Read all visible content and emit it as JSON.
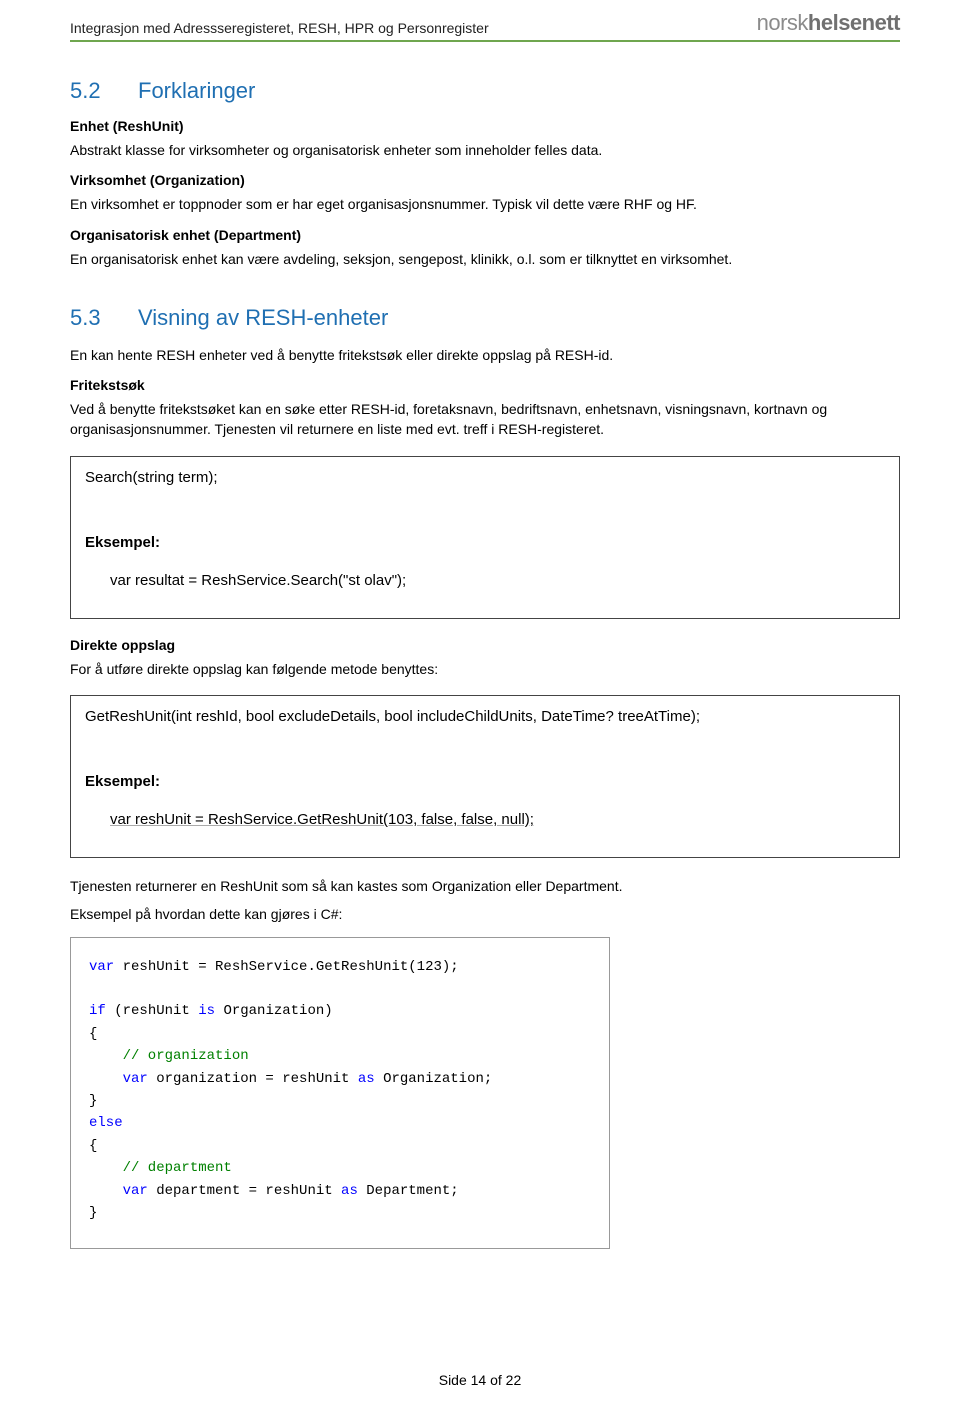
{
  "header": {
    "title": "Integrasjon med Adressseregisteret, RESH, HPR og Personregister",
    "logo_light": "norsk",
    "logo_bold": "helsenett"
  },
  "section_5_2": {
    "num": "5.2",
    "title": "Forklaringer",
    "terms": [
      {
        "name": "Enhet (ReshUnit)",
        "desc": "Abstrakt klasse for virksomheter og organisatorisk enheter som inneholder felles data."
      },
      {
        "name": "Virksomhet (Organization)",
        "desc": "En virksomhet er toppnoder som er har eget organisasjonsnummer. Typisk vil dette være RHF og HF."
      },
      {
        "name": "Organisatorisk enhet (Department)",
        "desc": "En organisatorisk enhet kan være avdeling, seksjon, sengepost, klinikk, o.l. som er tilknyttet en virksomhet."
      }
    ]
  },
  "section_5_3": {
    "num": "5.3",
    "title": "Visning av RESH-enheter",
    "intro": "En kan hente RESH enheter ved å benytte fritekstsøk eller direkte oppslag på RESH-id.",
    "fritekst_title": "Fritekstsøk",
    "fritekst_desc": "Ved å benytte fritekstsøket kan en søke etter RESH-id, foretaksnavn, bedriftsnavn, enhetsnavn, visningsnavn, kortnavn og organisasjonsnummer. Tjenesten vil returnere en liste med evt. treff i RESH-registeret.",
    "codebox1": {
      "signature": "Search(string term);",
      "example_label": "Eksempel:",
      "example_code": "var resultat = ReshService.Search(\"st olav\");"
    },
    "direkte_title": "Direkte oppslag",
    "direkte_desc": "For å utføre direkte oppslag kan følgende metode benyttes:",
    "codebox2": {
      "signature": "GetReshUnit(int reshId, bool excludeDetails, bool includeChildUnits, DateTime? treeAtTime);",
      "example_label": "Eksempel:",
      "example_code": "var reshUnit = ReshService.GetReshUnit(103, false, false, null);"
    },
    "after_box_1": "Tjenesten returnerer en ReshUnit som så kan kastes som Organization eller Department.",
    "after_box_2": "Eksempel på hvordan dette kan gjøres i C#:"
  },
  "csharp": {
    "l1a": "var",
    "l1b": " reshUnit = ReshService.GetReshUnit(123);",
    "l2a": "if",
    "l2b": " (reshUnit ",
    "l2c": "is",
    "l2d": " Organization)",
    "l3": "{",
    "l4": "    // organization",
    "l5a": "    var",
    "l5b": " organization = reshUnit ",
    "l5c": "as",
    "l5d": " Organization;",
    "l6": "}",
    "l7": "else",
    "l8": "{",
    "l9": "    // department",
    "l10a": "    var",
    "l10b": " department = reshUnit ",
    "l10c": "as",
    "l10d": " Department;",
    "l11": "}"
  },
  "footer": {
    "text": "Side 14 of 22"
  }
}
